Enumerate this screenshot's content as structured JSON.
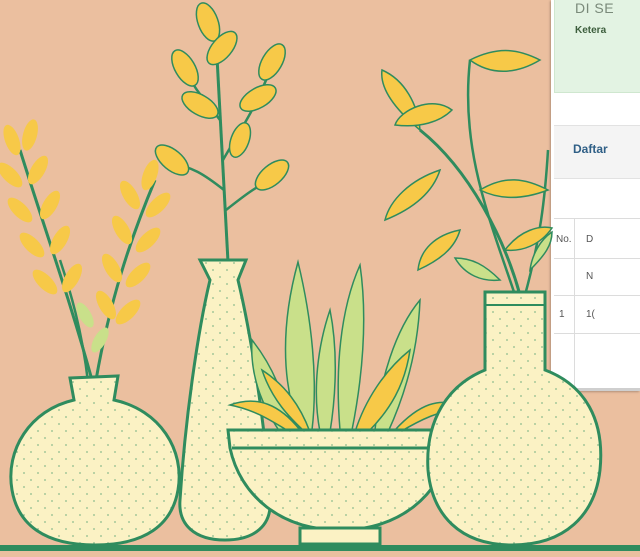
{
  "alert": {
    "title": "DI SE",
    "subtitle": "Ketera"
  },
  "section": {
    "title": "Daftar"
  },
  "table": {
    "headers": [
      "No.",
      "D"
    ],
    "subheaders": [
      "",
      "N"
    ],
    "rows": [
      [
        "1",
        "1("
      ]
    ]
  },
  "colors": {
    "background": "#ebbf9f",
    "leaf_yellow": "#f7c948",
    "leaf_green": "#c9e08a",
    "stem": "#2f8c5e",
    "vase": "#fbf2c4",
    "alert_bg": "#e3f3e3",
    "heading_blue": "#2f5f86"
  }
}
